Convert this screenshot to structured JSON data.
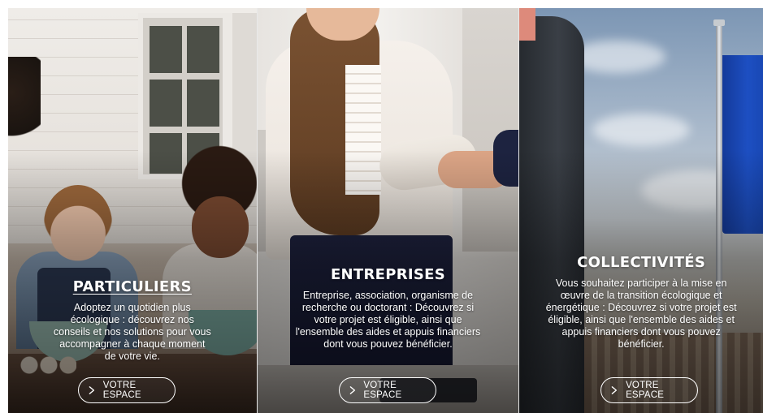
{
  "cards": [
    {
      "title": "PARTICULIERS",
      "description": "Adoptez un quotidien plus écologique : découvrez nos conseils et nos solutions pour vous accompagner à chaque moment de votre vie.",
      "button_label": "VOTRE ESPACE",
      "button_icon": "chevron-right-icon"
    },
    {
      "title": "ENTREPRISES",
      "description": "Entreprise, association, organisme de recherche ou doctorant : Découvrez si votre projet est éligible, ainsi que l'ensemble des aides et appuis financiers dont vous pouvez bénéficier.",
      "button_label": "VOTRE ESPACE",
      "button_icon": "chevron-right-icon"
    },
    {
      "title": "COLLECTIVITÉS",
      "description": "Vous souhaitez participer à la mise en œuvre de la transition écologique et énergétique : Découvrez si votre projet est éligible, ainsi que l'ensemble des aides et appuis financiers dont vous pouvez bénéficier.",
      "button_label": "VOTRE ESPACE",
      "button_icon": "chevron-right-icon"
    }
  ],
  "colors": {
    "text": "#ffffff",
    "divider": "#e9e9e9"
  }
}
